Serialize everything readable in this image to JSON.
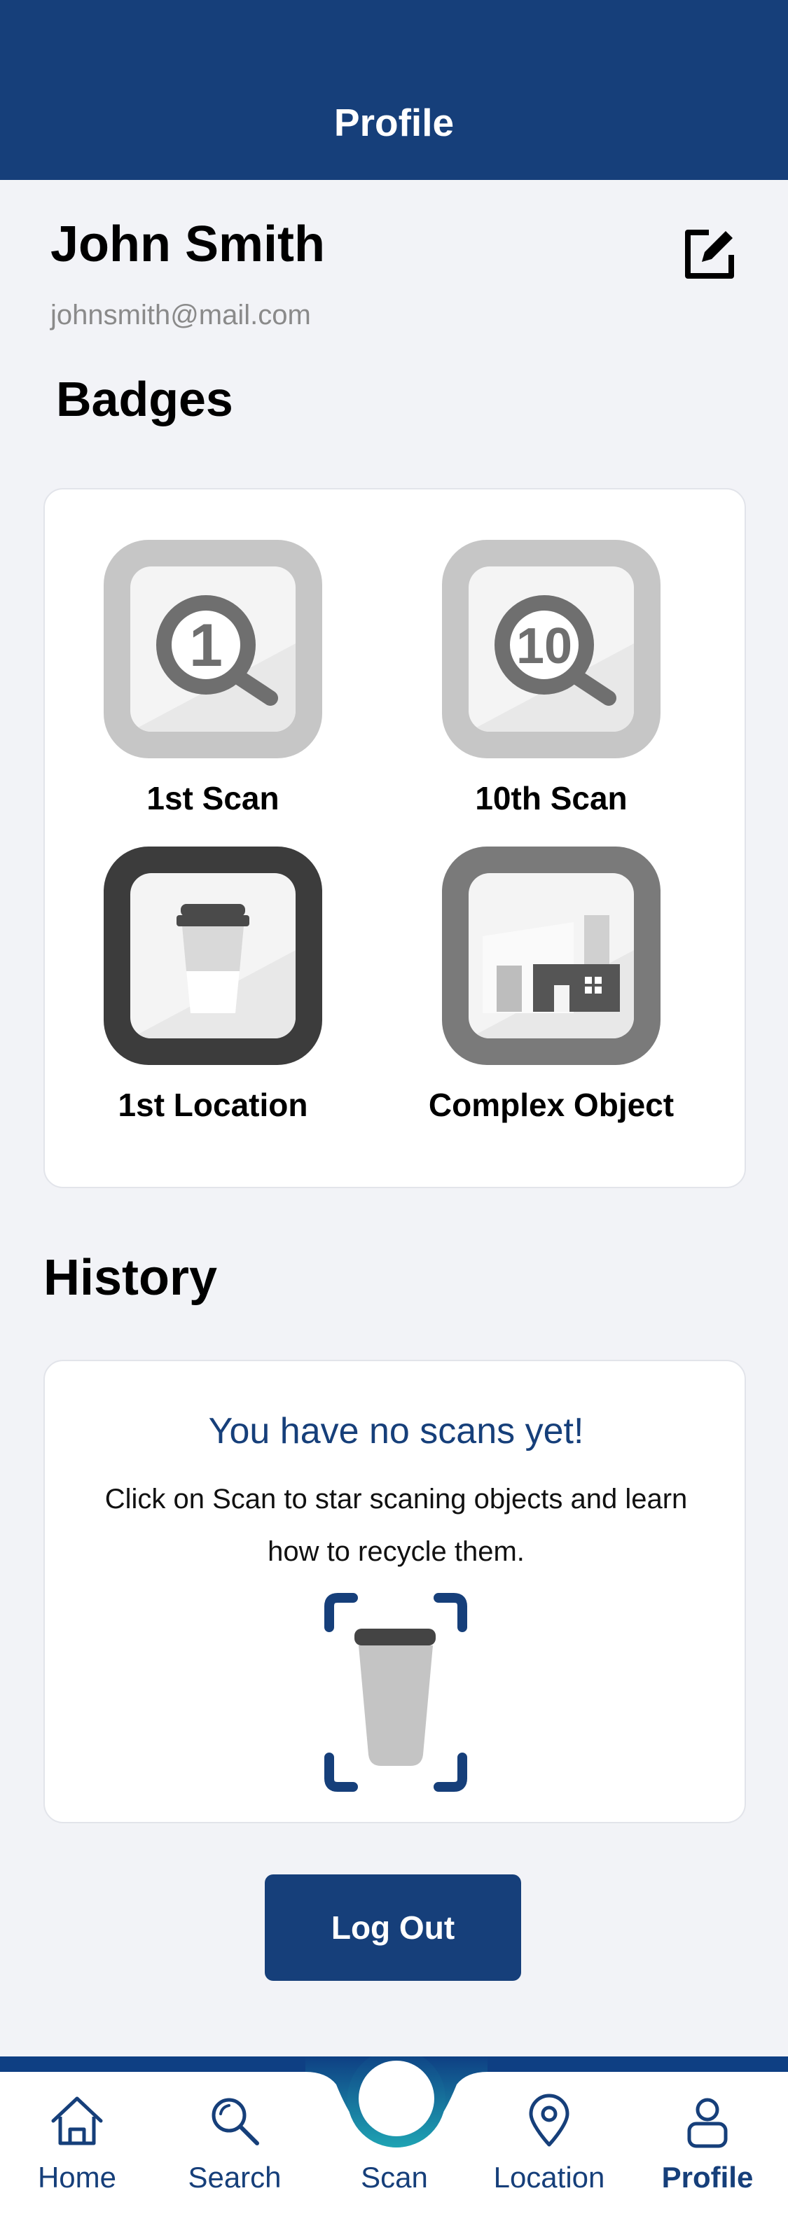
{
  "header": {
    "title": "Profile"
  },
  "profile": {
    "name": "John Smith",
    "email": "johnsmith@mail.com",
    "edit_icon": "edit-icon"
  },
  "badges": {
    "title": "Badges",
    "items": [
      {
        "label": "1st Scan",
        "icon": "magnifier-1-icon",
        "number": "1",
        "color": "#c6c6c6"
      },
      {
        "label": "10th Scan",
        "icon": "magnifier-10-icon",
        "number": "10",
        "color": "#c6c6c6"
      },
      {
        "label": "1st Location",
        "icon": "coffee-cup-icon",
        "color": "#3c3c3c"
      },
      {
        "label": "Complex Object",
        "icon": "factory-icon",
        "color": "#7a7a7a"
      }
    ]
  },
  "history": {
    "title": "History",
    "empty_title": "You have no scans yet!",
    "empty_text": "Click on Scan to star scaning objects and learn how to recycle them."
  },
  "logout": {
    "label": "Log Out"
  },
  "tabbar": {
    "items": [
      {
        "label": "Home",
        "icon": "home-icon"
      },
      {
        "label": "Search",
        "icon": "search-icon"
      },
      {
        "label": "Scan",
        "icon": "scan-icon"
      },
      {
        "label": "Location",
        "icon": "location-pin-icon"
      },
      {
        "label": "Profile",
        "icon": "user-icon",
        "active": true
      }
    ]
  },
  "colors": {
    "primary": "#163f7a",
    "background": "#f2f3f7"
  }
}
